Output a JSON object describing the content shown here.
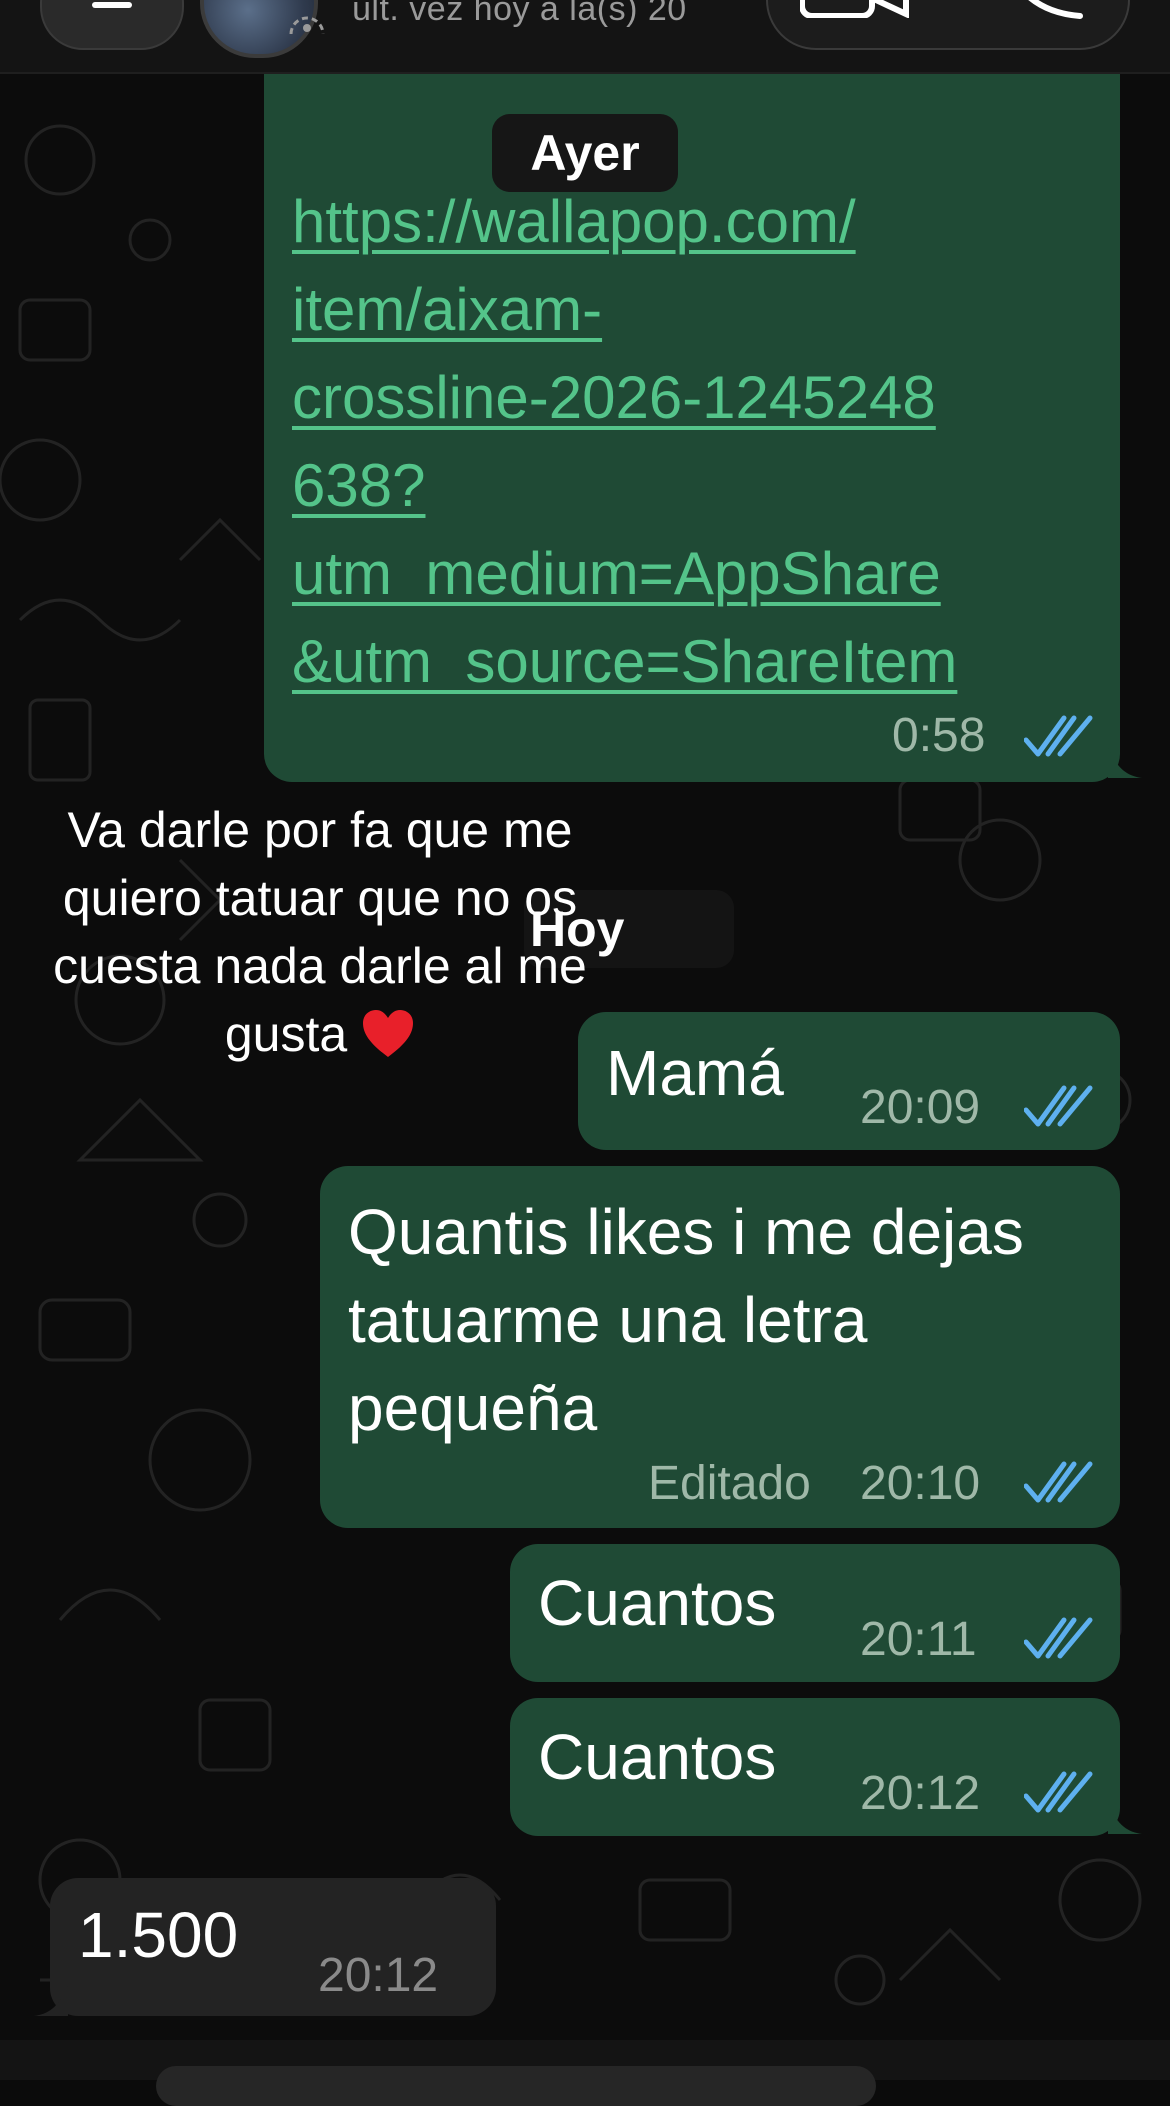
{
  "header": {
    "last_seen": "últ. vez hoy a la(s) 20"
  },
  "dates": {
    "ayer": "Ayer",
    "hoy": "Hoy"
  },
  "overlay_caption": {
    "line1": "Va darle por fa que me",
    "line2": "quiero tatuar que no os",
    "line3": "cuesta nada darle al me",
    "line4": "gusta"
  },
  "messages": [
    {
      "direction": "outgoing",
      "lines": [
        "https://wallapop.com/",
        "item/aixam-",
        "crossline-2026-1245248",
        "638?",
        "utm_medium=AppShare",
        "&utm_source=ShareItem"
      ],
      "time": "0:58",
      "status": "read"
    },
    {
      "direction": "outgoing",
      "text": "Mamá",
      "time": "20:09",
      "status": "read"
    },
    {
      "direction": "outgoing",
      "lines": [
        "Quantis likes i me dejas",
        "tatuarme una letra",
        "pequeña"
      ],
      "edited_label": "Editado",
      "time": "20:10",
      "status": "read"
    },
    {
      "direction": "outgoing",
      "text": "Cuantos",
      "time": "20:11",
      "status": "read"
    },
    {
      "direction": "outgoing",
      "text": "Cuantos",
      "time": "20:12",
      "status": "read"
    },
    {
      "direction": "incoming",
      "text": "1.500",
      "time": "20:12"
    }
  ],
  "colors": {
    "outgoing_bubble": "#1f4a35",
    "incoming_bubble": "#232323",
    "link": "#54c48a",
    "read_ticks": "#5eb0ef"
  }
}
